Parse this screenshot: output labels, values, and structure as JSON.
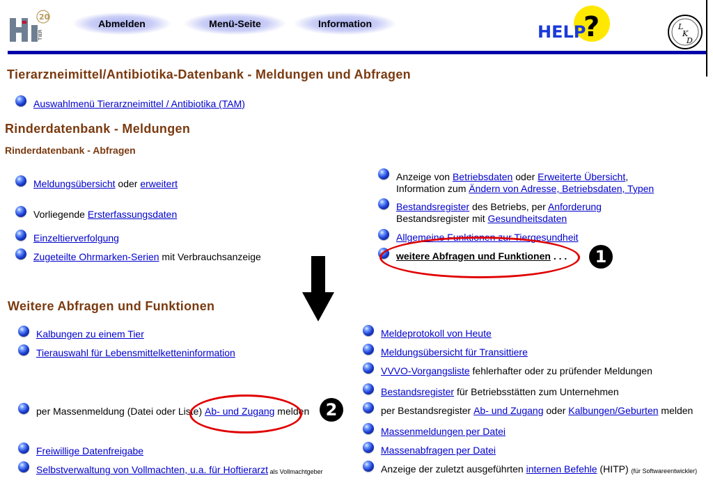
{
  "header": {
    "logo_text": "HI",
    "logo_sub": "TIER",
    "logo_badge": "20",
    "nav": [
      "Abmelden",
      "Menü-Seite",
      "Information"
    ],
    "help": "HELP",
    "lkd": "LKD"
  },
  "sections": {
    "tam_title": "Tierarzneimittel/Antibiotika-Datenbank - Meldungen und Abfragen",
    "tam_link": "Auswahlmenü Tierarzneimittel / Antibiotika (TAM)",
    "rind_title": "Rinderdatenbank - Meldungen",
    "rind_sub": "Rinderdatenbank - Abfragen",
    "weitere_title": "Weitere Abfragen und Funktionen"
  },
  "left_items": {
    "l1_link": "Meldungsübersicht",
    "l1_mid": " oder ",
    "l1_link2": "erweitert",
    "l2_pre": "Vorliegende ",
    "l2_link": "Ersterfassungsdaten",
    "l3_link": "Einzeltierverfolgung",
    "l4_link": "Zugeteilte Ohrmarken-Serien",
    "l4_post": " mit Verbrauchsanzeige"
  },
  "right_items": {
    "r1_pre": "Anzeige von ",
    "r1_link": "Betriebsdaten",
    "r1_mid": " oder ",
    "r1_link2": "Erweiterte Übersicht",
    "r1_post": ",",
    "r1_line2_pre": "Information zum ",
    "r1_line2_link": "Ändern von Adresse, Betriebsdaten, Typen",
    "r2_link": "Bestandsregister",
    "r2_mid": " des Betriebs, per ",
    "r2_link2": "Anforderung",
    "r2_line2_pre": "Bestandsregister mit ",
    "r2_line2_link": "Gesundheitsdaten",
    "r3_link": "Allgemeine Funktionen zur Tiergesundheit",
    "r4_bold": "weitere Abfragen und Funktionen",
    "r4_post": " . . ."
  },
  "weitere_left": {
    "w1": "Kalbungen zu einem Tier",
    "w2": "Tierauswahl für Lebensmittelketteninformation",
    "w3_pre": "per Massenmeldung (Datei oder Liste) ",
    "w3_link": "Ab- und Zugang",
    "w3_post": " melden",
    "w4": "Freiwillige Datenfreigabe",
    "w5_link": "Selbstverwaltung von Vollmachten, u.a. für Hoftierarzt",
    "w5_small": " als Vollmachtgeber"
  },
  "weitere_right": {
    "v1": "Meldeprotokoll von Heute",
    "v2": "Meldungsübersicht für Transittiere",
    "v3_link": "VVVO-Vorgangsliste",
    "v3_post": " fehlerhafter oder zu prüfender Meldungen",
    "v4_link": "Bestandsregister",
    "v4_post": " für Betriebsstätten zum Unternehmen",
    "v5_pre": "per Bestandsregister ",
    "v5_link": "Ab- und Zugang",
    "v5_mid": " oder ",
    "v5_link2": "Kalbungen/Geburten",
    "v5_post": " melden",
    "v6": "Massenmeldungen per Datei",
    "v7": "Massenabfragen per Datei",
    "v8_pre": "Anzeige der zuletzt ausgeführten ",
    "v8_link": "internen Befehle",
    "v8_post": " (HITP) ",
    "v8_small": "(für Softwareentwickler)"
  },
  "annotations": {
    "n1": "1",
    "n2": "2"
  },
  "colors": {
    "heading": "#7a3a10",
    "link": "#0000cc",
    "rule": "#0000aa",
    "annotation": "#e00000"
  }
}
